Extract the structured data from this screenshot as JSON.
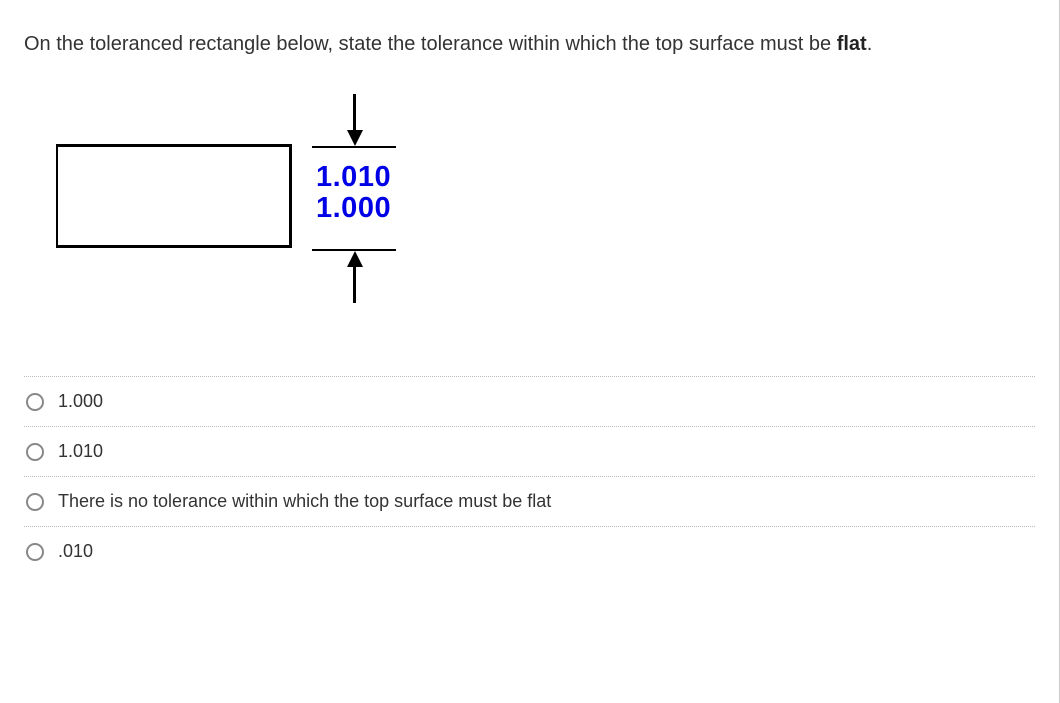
{
  "question": {
    "prefix": "On the toleranced rectangle below, state the tolerance within which the top surface must be ",
    "bold": "flat",
    "suffix": "."
  },
  "figure": {
    "dim_upper": "1.010",
    "dim_lower": "1.000"
  },
  "choices": [
    {
      "label": "1.000"
    },
    {
      "label": "1.010"
    },
    {
      "label": "There is no tolerance within which the top surface must be flat"
    },
    {
      "label": ".010"
    }
  ]
}
